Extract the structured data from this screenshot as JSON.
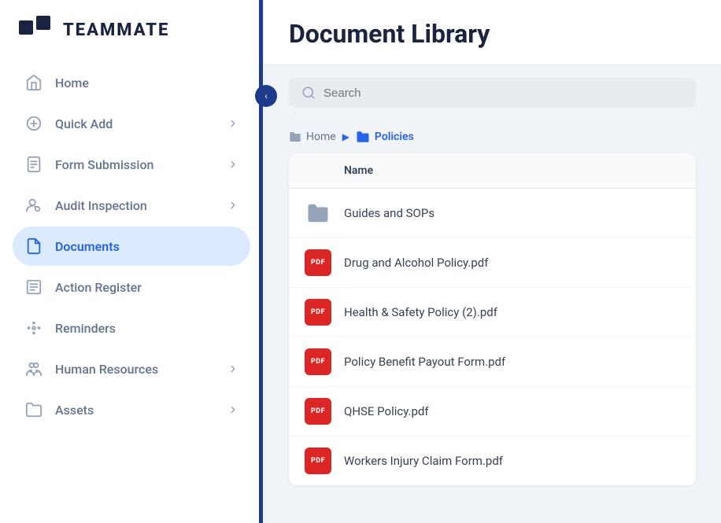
{
  "brand": {
    "name": "TEAMMATE"
  },
  "sidebar": {
    "items": [
      {
        "id": "home",
        "label": "Home",
        "icon": "home-icon",
        "hasChevron": false,
        "active": false
      },
      {
        "id": "quick-add",
        "label": "Quick Add",
        "icon": "quick-add-icon",
        "hasChevron": true,
        "active": false
      },
      {
        "id": "form-submission",
        "label": "Form Submission",
        "icon": "form-icon",
        "hasChevron": true,
        "active": false
      },
      {
        "id": "audit-inspection",
        "label": "Audit Inspection",
        "icon": "audit-icon",
        "hasChevron": true,
        "active": false
      },
      {
        "id": "documents",
        "label": "Documents",
        "icon": "documents-icon",
        "hasChevron": false,
        "active": true
      },
      {
        "id": "action-register",
        "label": "Action Register",
        "icon": "action-icon",
        "hasChevron": false,
        "active": false
      },
      {
        "id": "reminders",
        "label": "Reminders",
        "icon": "reminders-icon",
        "hasChevron": false,
        "active": false
      },
      {
        "id": "human-resources",
        "label": "Human Resources",
        "icon": "hr-icon",
        "hasChevron": true,
        "active": false
      },
      {
        "id": "assets",
        "label": "Assets",
        "icon": "assets-icon",
        "hasChevron": true,
        "active": false
      }
    ],
    "collapse_label": "‹"
  },
  "main": {
    "page_title": "Document Library",
    "search": {
      "placeholder": "Search"
    },
    "breadcrumb": {
      "home": "Home",
      "current": "Policies"
    },
    "table": {
      "col_name": "Name",
      "rows": [
        {
          "id": "guides",
          "type": "folder",
          "name": "Guides and SOPs"
        },
        {
          "id": "drug",
          "type": "pdf",
          "name": "Drug and Alcohol Policy.pdf"
        },
        {
          "id": "health",
          "type": "pdf",
          "name": "Health & Safety Policy (2).pdf"
        },
        {
          "id": "benefit",
          "type": "pdf",
          "name": "Policy Benefit Payout Form.pdf"
        },
        {
          "id": "qhse",
          "type": "pdf",
          "name": "QHSE Policy.pdf"
        },
        {
          "id": "workers",
          "type": "pdf",
          "name": "Workers Injury Claim Form.pdf"
        }
      ]
    }
  }
}
